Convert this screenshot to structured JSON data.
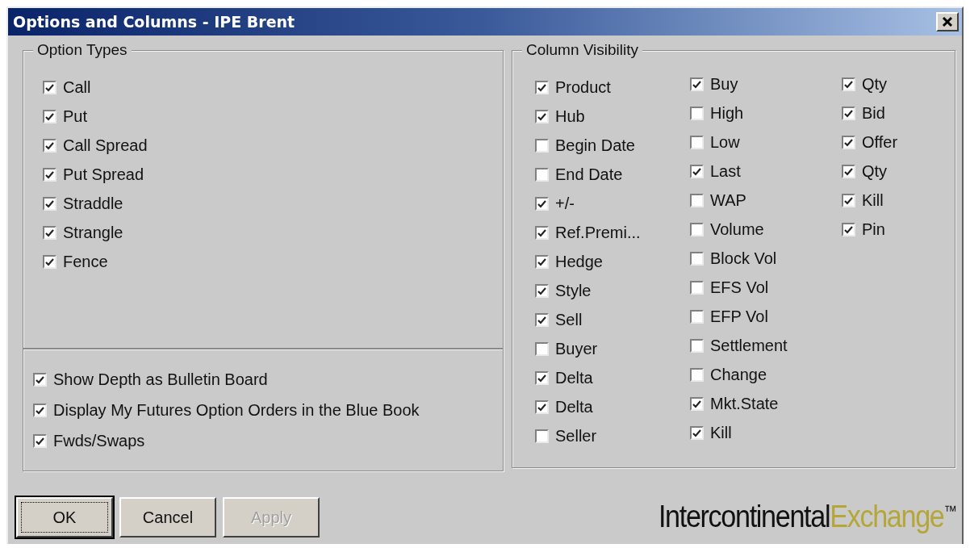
{
  "window": {
    "title": "Options and Columns - IPE Brent"
  },
  "option_types": {
    "title": "Option Types",
    "items": [
      {
        "label": "Call",
        "checked": true
      },
      {
        "label": "Put",
        "checked": true
      },
      {
        "label": "Call Spread",
        "checked": true
      },
      {
        "label": "Put Spread",
        "checked": true
      },
      {
        "label": "Straddle",
        "checked": true
      },
      {
        "label": "Strangle",
        "checked": true
      },
      {
        "label": "Fence",
        "checked": true
      }
    ]
  },
  "display_options": [
    {
      "label": "Show Depth as Bulletin Board",
      "checked": true
    },
    {
      "label": "Display My Futures Option Orders in the Blue Book",
      "checked": true
    },
    {
      "label": "Fwds/Swaps",
      "checked": true
    }
  ],
  "column_visibility": {
    "title": "Column Visibility",
    "columns": [
      {
        "items": [
          {
            "label": "Product",
            "checked": true
          },
          {
            "label": "Hub",
            "checked": true
          },
          {
            "label": "Begin Date",
            "checked": false
          },
          {
            "label": "End Date",
            "checked": false
          },
          {
            "label": "+/-",
            "checked": true
          },
          {
            "label": "Ref.Premi...",
            "checked": true
          },
          {
            "label": "Hedge",
            "checked": true
          },
          {
            "label": "Style",
            "checked": true
          },
          {
            "label": "Sell",
            "checked": true
          },
          {
            "label": "Buyer",
            "checked": false
          },
          {
            "label": "Delta",
            "checked": true
          },
          {
            "label": "Delta",
            "checked": true
          },
          {
            "label": "Seller",
            "checked": false
          }
        ]
      },
      {
        "items": [
          {
            "label": "Buy",
            "checked": true
          },
          {
            "label": "High",
            "checked": false
          },
          {
            "label": "Low",
            "checked": false
          },
          {
            "label": "Last",
            "checked": true
          },
          {
            "label": "WAP",
            "checked": false
          },
          {
            "label": "Volume",
            "checked": false
          },
          {
            "label": "Block Vol",
            "checked": false
          },
          {
            "label": "EFS Vol",
            "checked": false
          },
          {
            "label": "EFP Vol",
            "checked": false
          },
          {
            "label": "Settlement",
            "checked": false
          },
          {
            "label": "Change",
            "checked": false
          },
          {
            "label": "Mkt.State",
            "checked": true
          },
          {
            "label": "Kill",
            "checked": true
          }
        ]
      },
      {
        "items": [
          {
            "label": "Qty",
            "checked": true
          },
          {
            "label": "Bid",
            "checked": true
          },
          {
            "label": "Offer",
            "checked": true
          },
          {
            "label": "Qty",
            "checked": true
          },
          {
            "label": "Kill",
            "checked": true
          },
          {
            "label": "Pin",
            "checked": true
          }
        ]
      }
    ]
  },
  "buttons": [
    {
      "label": "OK",
      "default": true,
      "disabled": false
    },
    {
      "label": "Cancel",
      "default": false,
      "disabled": false
    },
    {
      "label": "Apply",
      "default": false,
      "disabled": true
    }
  ],
  "logo": {
    "first": "Intercontinental",
    "second": "Exchange",
    "mark": "™"
  }
}
